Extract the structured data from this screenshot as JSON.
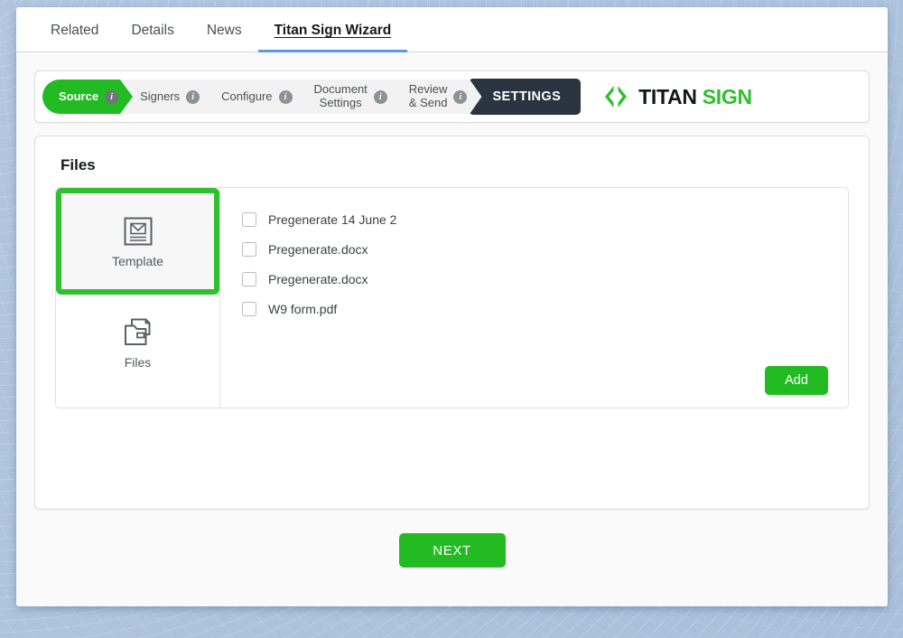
{
  "tabs": [
    {
      "label": "Related",
      "active": false
    },
    {
      "label": "Details",
      "active": false
    },
    {
      "label": "News",
      "active": false
    },
    {
      "label": "Titan Sign Wizard",
      "active": true
    }
  ],
  "wizard": {
    "steps": [
      {
        "label": "Source",
        "label2": "",
        "state": "active",
        "info": "i"
      },
      {
        "label": "Signers",
        "label2": "",
        "state": "inactive",
        "info": "i"
      },
      {
        "label": "Configure",
        "label2": "",
        "state": "inactive",
        "info": "i"
      },
      {
        "label": "Document",
        "label2": "Settings",
        "state": "inactive",
        "info": "i"
      },
      {
        "label": "Review",
        "label2": "& Send",
        "state": "inactive",
        "info": "i"
      }
    ],
    "settings_label": "SETTINGS",
    "logo": {
      "text_dark": "TITAN",
      "text_green": "SIGN"
    }
  },
  "files_panel": {
    "title": "Files",
    "tiles": [
      {
        "name": "Template",
        "icon": "template-icon",
        "selected": true
      },
      {
        "name": "Files",
        "icon": "folder-icon",
        "selected": false
      }
    ],
    "file_items": [
      {
        "label": "Pregenerate 14 June 2",
        "checked": false
      },
      {
        "label": "Pregenerate.docx",
        "checked": false
      },
      {
        "label": "Pregenerate.docx",
        "checked": false
      },
      {
        "label": "W9 form.pdf",
        "checked": false
      }
    ],
    "add_label": "Add"
  },
  "footer": {
    "next_label": "NEXT"
  },
  "colors": {
    "brand_green": "#22bb22",
    "logo_green": "#2fc02f",
    "settings_dark": "#2a3340",
    "tab_underline": "#5a9ae0",
    "selection_outline": "#2fc02f",
    "page_background": "#aec3de"
  }
}
